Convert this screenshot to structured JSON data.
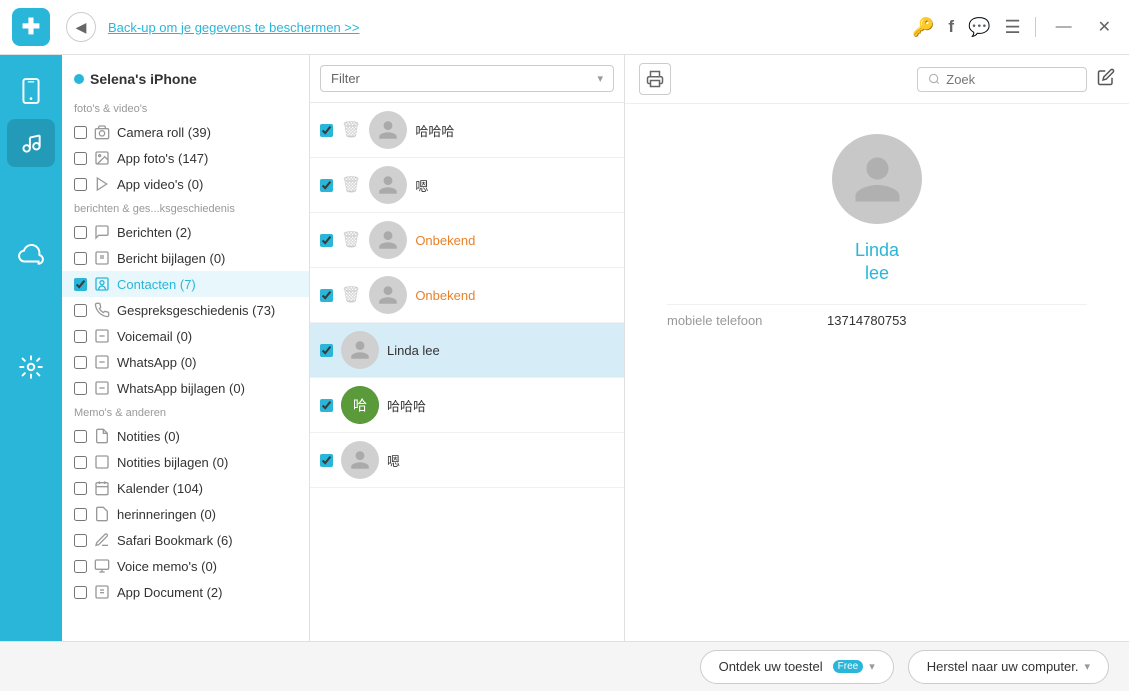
{
  "app": {
    "logo_char": "✚",
    "back_title": "Back-up om je gegevens te beschermen >>",
    "icons_right": [
      "key",
      "facebook",
      "chat",
      "menu"
    ],
    "win_min": "—",
    "win_close": "✕"
  },
  "icon_sidebar": {
    "items": [
      {
        "name": "phone-icon",
        "char": "📱",
        "active": false
      },
      {
        "name": "music-icon",
        "char": "🎵",
        "active": true
      },
      {
        "name": "cloud-icon",
        "char": "☁",
        "active": false
      },
      {
        "name": "tools-icon",
        "char": "🔧",
        "active": false
      }
    ]
  },
  "tree": {
    "device_name": "Selena's iPhone",
    "sections": [
      {
        "title": "foto's & video's",
        "items": [
          {
            "label": "Camera roll (39)",
            "checked": false,
            "icon": "📷",
            "active": false
          },
          {
            "label": "App foto's (147)",
            "checked": false,
            "icon": "🖼",
            "active": false
          },
          {
            "label": "App video's (0)",
            "checked": false,
            "icon": "▶",
            "active": false
          }
        ]
      },
      {
        "title": "berichten & ges...ksgeschiedenis",
        "items": [
          {
            "label": "Berichten (2)",
            "checked": false,
            "icon": "💬",
            "active": false
          },
          {
            "label": "Bericht bijlagen (0)",
            "checked": false,
            "icon": "📎",
            "active": false
          },
          {
            "label": "Contacten (7)",
            "checked": true,
            "icon": "👤",
            "active": true
          },
          {
            "label": "Gespreksgeschiedenis (73)",
            "checked": false,
            "icon": "📞",
            "active": false
          },
          {
            "label": "Voicemail (0)",
            "checked": false,
            "icon": "📎",
            "active": false
          },
          {
            "label": "WhatsApp (0)",
            "checked": false,
            "icon": "📎",
            "active": false
          },
          {
            "label": "WhatsApp bijlagen (0)",
            "checked": false,
            "icon": "📎",
            "active": false
          }
        ]
      },
      {
        "title": "Memo's & anderen",
        "items": [
          {
            "label": "Notities (0)",
            "checked": false,
            "icon": "📝",
            "active": false
          },
          {
            "label": "Notities bijlagen (0)",
            "checked": false,
            "icon": "📎",
            "active": false
          },
          {
            "label": "Kalender (104)",
            "checked": false,
            "icon": "📅",
            "active": false
          },
          {
            "label": "herinneringen (0)",
            "checked": false,
            "icon": "📝",
            "active": false
          },
          {
            "label": "Safari Bookmark (6)",
            "checked": false,
            "icon": "✏",
            "active": false
          },
          {
            "label": "Voice memo's (0)",
            "checked": false,
            "icon": "🎵",
            "active": false
          },
          {
            "label": "App Document (2)",
            "checked": false,
            "icon": "📄",
            "active": false
          }
        ]
      }
    ]
  },
  "list_panel": {
    "filter_label": "Filter",
    "print_icon": "🖨",
    "search_placeholder": "Zoek",
    "items": [
      {
        "id": 1,
        "name": "哈哈哈",
        "checked": true,
        "has_delete": true,
        "selected": false,
        "avatar_type": "default",
        "name_color": "normal"
      },
      {
        "id": 2,
        "name": "嗯",
        "checked": true,
        "has_delete": true,
        "selected": false,
        "avatar_type": "default",
        "name_color": "normal"
      },
      {
        "id": 3,
        "name": "Onbekend",
        "checked": true,
        "has_delete": true,
        "selected": false,
        "avatar_type": "default",
        "name_color": "orange"
      },
      {
        "id": 4,
        "name": "Onbekend",
        "checked": true,
        "has_delete": true,
        "selected": false,
        "avatar_type": "default",
        "name_color": "orange"
      },
      {
        "id": 5,
        "name": "Linda lee",
        "checked": true,
        "has_delete": false,
        "selected": true,
        "avatar_type": "default",
        "name_color": "normal"
      },
      {
        "id": 6,
        "name": "哈哈哈",
        "checked": true,
        "has_delete": false,
        "selected": false,
        "avatar_type": "photo",
        "name_color": "normal"
      },
      {
        "id": 7,
        "name": "嗯",
        "checked": true,
        "has_delete": false,
        "selected": false,
        "avatar_type": "default",
        "name_color": "normal"
      }
    ]
  },
  "detail": {
    "avatar_char": "👤",
    "first_name": "Linda",
    "last_name": "lee",
    "field_label": "mobiele telefoon",
    "field_value": "13714780753",
    "edit_icon": "✏",
    "search_placeholder": "Zoek"
  },
  "bottom": {
    "discover_label": "Ontdek uw toestel",
    "discover_badge": "Free",
    "restore_label": "Herstel naar uw computer.",
    "chevron": "▾"
  }
}
